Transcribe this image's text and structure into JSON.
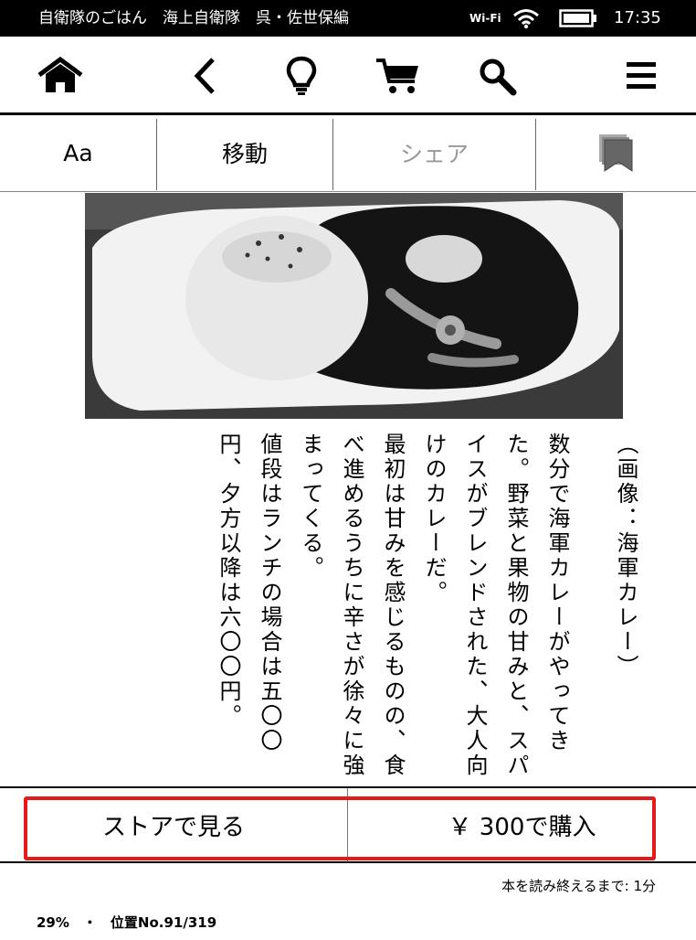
{
  "status_bar": {
    "book_title": "自衛隊のごはん　海上自衛隊　呉・佐世保編",
    "wifi_label": "Wi-Fi",
    "clock": "17:35",
    "icons": [
      "wifi-icon",
      "battery-icon"
    ]
  },
  "toolbar": {
    "icons": [
      "home-icon",
      "back-icon",
      "lightbulb-icon",
      "cart-icon",
      "search-icon",
      "menu-icon"
    ]
  },
  "subbar": {
    "font_label": "Aa",
    "goto_label": "移動",
    "share_label": "シェア",
    "bookmark_icon": "bookmark-icon",
    "share_color": "#999999"
  },
  "content": {
    "image_alt": "海軍カレー",
    "caption": "（画像：海軍カレー）",
    "paragraphs": [
      "数分で海軍カレーがやってきた。野菜と果物の甘みと、スパイスがブレンドされた、大人向けのカレーだ。",
      "最初は甘みを感じるものの、食べ進めるうちに辛さが徐々に強まってくる。",
      "値段はランチの場合は五〇〇円、夕方以降は六〇〇円。"
    ]
  },
  "purchase": {
    "store_label": "ストアで見る",
    "buy_label": "￥ 300で購入",
    "highlight_color": "#e41b1b"
  },
  "footer": {
    "time_left": "本を読み終えるまで: 1分",
    "location": "29%　・　位置No.91/319"
  }
}
